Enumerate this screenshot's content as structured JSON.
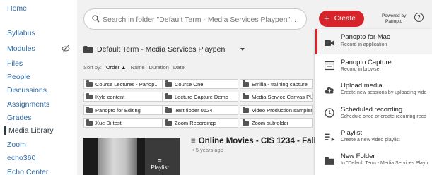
{
  "nav": {
    "items": [
      {
        "label": "Home"
      },
      {
        "label": "Syllabus"
      },
      {
        "label": "Modules"
      },
      {
        "label": "Files"
      },
      {
        "label": "People"
      },
      {
        "label": "Discussions"
      },
      {
        "label": "Assignments"
      },
      {
        "label": "Grades"
      },
      {
        "label": "Media Library"
      },
      {
        "label": "Zoom"
      },
      {
        "label": "echo360"
      },
      {
        "label": "Echo Center"
      }
    ],
    "active": "Media Library"
  },
  "search": {
    "placeholder": "Search in folder \"Default Term - Media Services Playpen\"..."
  },
  "folder": {
    "title": "Default Term - Media Services Playpen"
  },
  "sort": {
    "label": "Sort by:",
    "order": "Order ▲",
    "options": [
      "Name",
      "Duration",
      "Date"
    ]
  },
  "subfolders": [
    "Course Lectures - Panop...",
    "Course One",
    "Emilia - training capture",
    "Kyle content",
    "Lecture Capture Demo",
    "Media Service Canvas Pl...",
    "Panopto for Editing",
    "Test floder 0624",
    "Video Production samples",
    "Xue Di test",
    "Zoom Recordings",
    "Zoom subfolder"
  ],
  "session": {
    "title": "Online Movies - CIS 1234 - Fall 2020",
    "meta": "• 5 years ago",
    "thumb_label": "Playlist"
  },
  "header": {
    "create_label": "Create",
    "powered_by": "Powered by",
    "powered_brand": "Panopto",
    "help": "?"
  },
  "create_menu": [
    {
      "title": "Panopto for Mac",
      "subtitle": "Record in application",
      "icon": "camera-icon"
    },
    {
      "title": "Panopto Capture",
      "subtitle": "Record in browser",
      "icon": "browser-icon"
    },
    {
      "title": "Upload media",
      "subtitle": "Create new sessions by uploading vide",
      "icon": "cloud-upload-icon"
    },
    {
      "title": "Scheduled recording",
      "subtitle": "Schedule once or create recurring reco",
      "icon": "clock-icon"
    },
    {
      "title": "Playlist",
      "subtitle": "Create a new video playlist",
      "icon": "playlist-icon"
    },
    {
      "title": "New Folder",
      "subtitle": "In \"Default Term - Media Services Playp",
      "icon": "folder-icon"
    }
  ],
  "colors": {
    "accent": "#d6242a",
    "nav_link": "#2d6aa5",
    "frame_bg": "#f1f1f1"
  }
}
